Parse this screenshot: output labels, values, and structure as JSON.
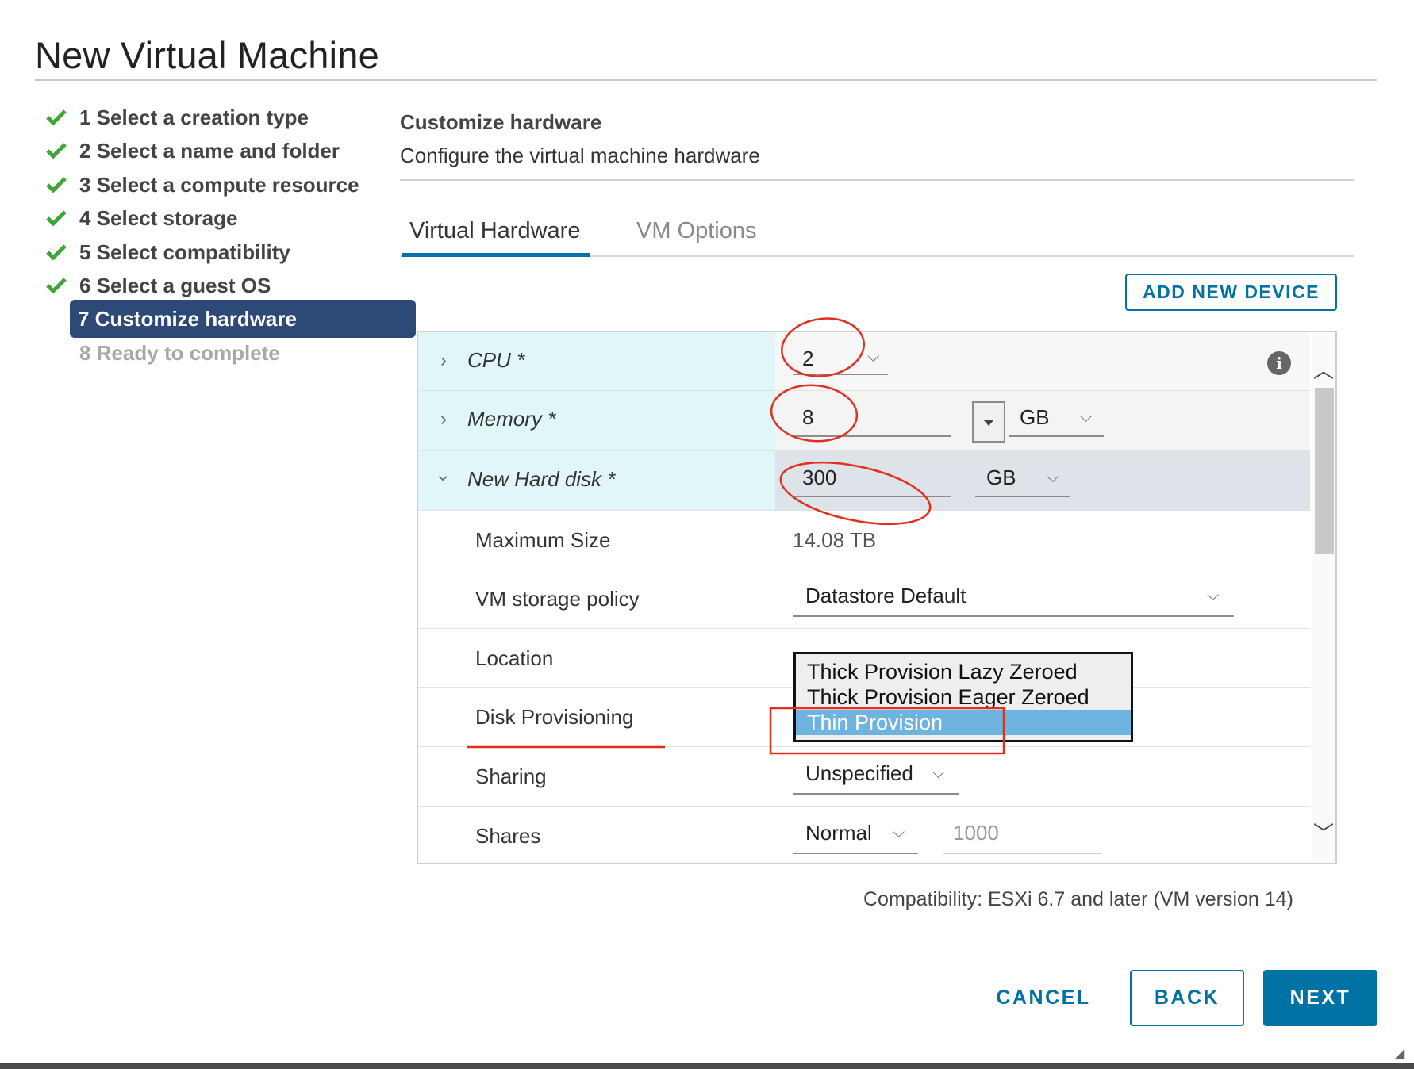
{
  "dialog": {
    "title": "New Virtual Machine"
  },
  "steps": [
    {
      "label": "1 Select a creation type",
      "status": "done"
    },
    {
      "label": "2 Select a name and folder",
      "status": "done"
    },
    {
      "label": "3 Select a compute resource",
      "status": "done"
    },
    {
      "label": "4 Select storage",
      "status": "done"
    },
    {
      "label": "5 Select compatibility",
      "status": "done"
    },
    {
      "label": "6 Select a guest OS",
      "status": "done"
    },
    {
      "label": "7 Customize hardware",
      "status": "active"
    },
    {
      "label": "8 Ready to complete",
      "status": "pending"
    }
  ],
  "content": {
    "title": "Customize hardware",
    "subtitle": "Configure the virtual machine hardware",
    "tabs": [
      {
        "label": "Virtual Hardware",
        "active": true
      },
      {
        "label": "VM Options",
        "active": false
      }
    ],
    "add_device_label": "ADD NEW DEVICE"
  },
  "hardware": {
    "cpu": {
      "name": "CPU *",
      "value": "2"
    },
    "memory": {
      "name": "Memory *",
      "value": "8",
      "unit": "GB"
    },
    "hard_disk": {
      "name": "New Hard disk *",
      "value": "300",
      "unit": "GB",
      "maximum_size_label": "Maximum Size",
      "maximum_size_value": "14.08 TB",
      "storage_policy_label": "VM storage policy",
      "storage_policy_value": "Datastore Default",
      "location_label": "Location",
      "disk_provisioning_label": "Disk Provisioning",
      "provisioning_options": [
        "Thick Provision Lazy Zeroed",
        "Thick Provision Eager Zeroed",
        "Thin Provision"
      ],
      "provisioning_selected": "Thin Provision",
      "sharing_label": "Sharing",
      "sharing_value": "Unspecified",
      "shares_label": "Shares",
      "shares_value": "Normal",
      "shares_amount": "1000"
    }
  },
  "compatibility": "Compatibility: ESXi 6.7 and later (VM version 14)",
  "buttons": {
    "cancel": "CANCEL",
    "back": "BACK",
    "next": "NEXT"
  },
  "colors": {
    "accent": "#0072a3",
    "active_step": "#2d4a77",
    "check": "#3fa535",
    "annotation": "#e0301e",
    "selected_option": "#6fb3e0"
  },
  "icons": {
    "check": "check-icon",
    "info": "info-icon",
    "chevron": "chevron-icon",
    "scroll": "scroll-arrow-icon"
  }
}
